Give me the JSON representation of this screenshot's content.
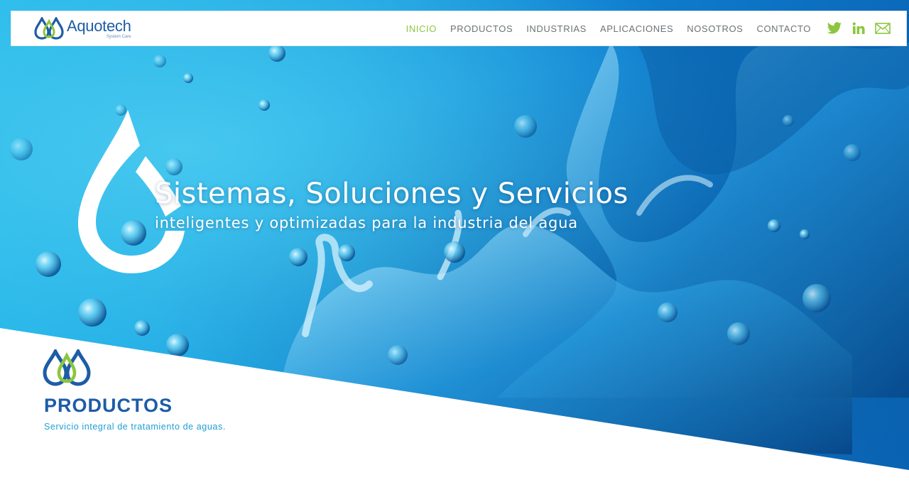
{
  "brand": {
    "name": "Aquotech",
    "tagline": "System Care"
  },
  "nav": {
    "items": [
      {
        "label": "INICIO",
        "active": true
      },
      {
        "label": "PRODUCTOS",
        "active": false
      },
      {
        "label": "INDUSTRIAS",
        "active": false
      },
      {
        "label": "APLICACIONES",
        "active": false
      },
      {
        "label": "NOSOTROS",
        "active": false
      },
      {
        "label": "CONTACTO",
        "active": false
      }
    ],
    "social": [
      "twitter-icon",
      "linkedin-icon",
      "mail-icon"
    ]
  },
  "hero": {
    "title": "Sistemas, Soluciones y Servicios",
    "subtitle": "inteligentes y optimizadas para la industria del agua"
  },
  "products": {
    "title": "PRODUCTOS",
    "description": "Servicio integral de tratamiento de aguas."
  },
  "colors": {
    "brand_blue": "#1d5ca6",
    "brand_green": "#8cc63f",
    "accent_cyan": "#1d9fd3",
    "nav_text": "#6d7275"
  }
}
